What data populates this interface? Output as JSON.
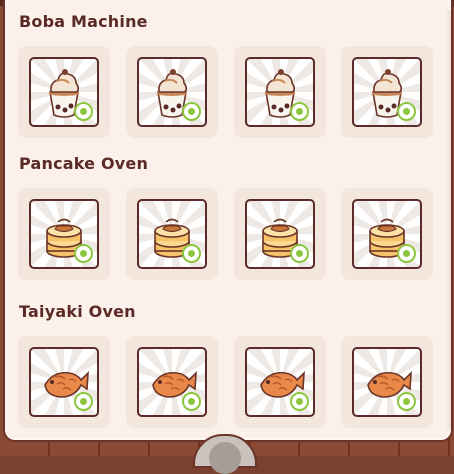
{
  "sections": [
    {
      "title": "Boba Machine",
      "item_icon": "boba-cup-icon",
      "slots": [
        {
          "status": "unlocked",
          "badge_icon": "refresh-badge-icon"
        },
        {
          "status": "unlocked",
          "badge_icon": "refresh-badge-icon"
        },
        {
          "status": "unlocked",
          "badge_icon": "refresh-badge-icon"
        },
        {
          "status": "unlocked",
          "badge_icon": "refresh-badge-icon"
        }
      ]
    },
    {
      "title": "Pancake Oven",
      "item_icon": "pancake-stack-icon",
      "slots": [
        {
          "status": "unlocked",
          "badge_icon": "refresh-badge-icon"
        },
        {
          "status": "unlocked",
          "badge_icon": "refresh-badge-icon"
        },
        {
          "status": "unlocked",
          "badge_icon": "refresh-badge-icon"
        },
        {
          "status": "unlocked",
          "badge_icon": "refresh-badge-icon"
        }
      ]
    },
    {
      "title": "Taiyaki Oven",
      "item_icon": "taiyaki-fish-icon",
      "slots": [
        {
          "status": "unlocked",
          "badge_icon": "refresh-badge-icon"
        },
        {
          "status": "unlocked",
          "badge_icon": "refresh-badge-icon"
        },
        {
          "status": "unlocked",
          "badge_icon": "refresh-badge-icon"
        },
        {
          "status": "unlocked",
          "badge_icon": "refresh-badge-icon"
        }
      ]
    }
  ],
  "colors": {
    "panel_bg": "#fcf1ea",
    "slot_bg": "#f3e6dd",
    "frame_border": "#5c2a2a",
    "title_text": "#5a2a26",
    "badge_green": "#8cc63f"
  }
}
